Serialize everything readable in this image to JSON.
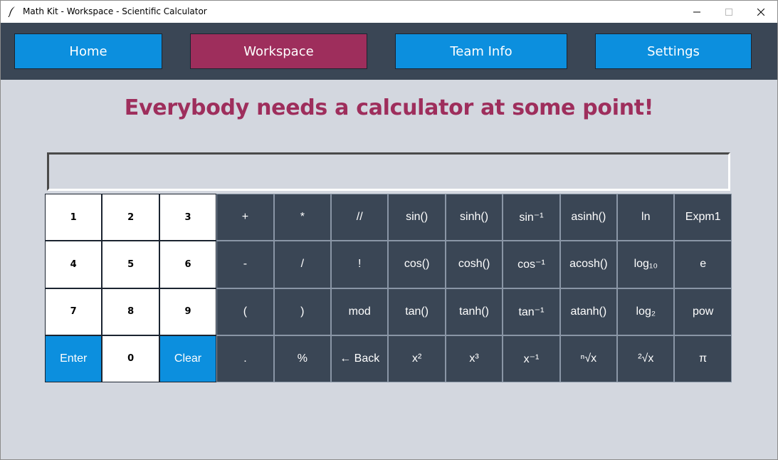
{
  "window": {
    "title": "Math Kit - Workspace - Scientific Calculator",
    "icon": "feather-icon"
  },
  "nav": {
    "home": "Home",
    "workspace": "Workspace",
    "team": "Team Info",
    "settings": "Settings"
  },
  "heading": "Everybody needs a calculator at some point!",
  "display": {
    "value": ""
  },
  "keys": [
    {
      "label": "1",
      "style": "light"
    },
    {
      "label": "2",
      "style": "light"
    },
    {
      "label": "3",
      "style": "light"
    },
    {
      "label": "+",
      "style": "dark"
    },
    {
      "label": "*",
      "style": "dark"
    },
    {
      "label": "//",
      "style": "dark"
    },
    {
      "label": "sin()",
      "style": "dark"
    },
    {
      "label": "sinh()",
      "style": "dark"
    },
    {
      "label": "sin⁻¹",
      "style": "dark"
    },
    {
      "label": "asinh()",
      "style": "dark"
    },
    {
      "label": "ln",
      "style": "dark"
    },
    {
      "label": "Expm1",
      "style": "dark"
    },
    {
      "label": "4",
      "style": "light"
    },
    {
      "label": "5",
      "style": "light"
    },
    {
      "label": "6",
      "style": "light"
    },
    {
      "label": "-",
      "style": "dark"
    },
    {
      "label": "/",
      "style": "dark"
    },
    {
      "label": "!",
      "style": "dark"
    },
    {
      "label": "cos()",
      "style": "dark"
    },
    {
      "label": "cosh()",
      "style": "dark"
    },
    {
      "label": "cos⁻¹",
      "style": "dark"
    },
    {
      "label": "acosh()",
      "style": "dark"
    },
    {
      "label": "log₁₀",
      "style": "dark"
    },
    {
      "label": "e",
      "style": "dark"
    },
    {
      "label": "7",
      "style": "light"
    },
    {
      "label": "8",
      "style": "light"
    },
    {
      "label": "9",
      "style": "light"
    },
    {
      "label": "(",
      "style": "dark"
    },
    {
      "label": ")",
      "style": "dark"
    },
    {
      "label": "mod",
      "style": "dark"
    },
    {
      "label": "tan()",
      "style": "dark"
    },
    {
      "label": "tanh()",
      "style": "dark"
    },
    {
      "label": "tan⁻¹",
      "style": "dark"
    },
    {
      "label": "atanh()",
      "style": "dark"
    },
    {
      "label": "log₂",
      "style": "dark"
    },
    {
      "label": "pow",
      "style": "dark"
    },
    {
      "label": "Enter",
      "style": "blue"
    },
    {
      "label": "0",
      "style": "light"
    },
    {
      "label": "Clear",
      "style": "blue"
    },
    {
      "label": ".",
      "style": "dark"
    },
    {
      "label": "%",
      "style": "dark"
    },
    {
      "label": "← Back",
      "style": "dark"
    },
    {
      "label": "x²",
      "style": "dark"
    },
    {
      "label": "x³",
      "style": "dark"
    },
    {
      "label": "x⁻¹",
      "style": "dark"
    },
    {
      "label": "ⁿ√x",
      "style": "dark"
    },
    {
      "label": "²√x",
      "style": "dark"
    },
    {
      "label": "π",
      "style": "dark"
    }
  ],
  "colors": {
    "nav_bg": "#3a4655",
    "accent_blue": "#0c8fde",
    "accent_magenta": "#9e2e5c",
    "content_bg": "#d3d7df"
  }
}
